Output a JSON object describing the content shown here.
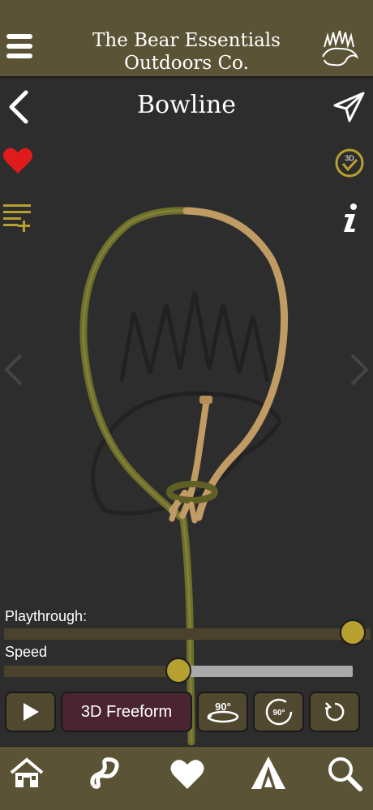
{
  "app": {
    "brand_line1": "The Bear Essentials",
    "brand_line2": "Outdoors Co."
  },
  "knot": {
    "title": "Bowline",
    "favorited": true
  },
  "icons": {
    "menu": "menu-icon",
    "logo": "bear-paw-logo",
    "back": "chevron-left-icon",
    "share": "send-icon",
    "favorite": "heart-icon",
    "mode_3d": "3d-check-icon",
    "add_list": "playlist-add-icon",
    "info": "info-icon"
  },
  "controls": {
    "playthrough_label": "Playthrough:",
    "playthrough_value": 0.97,
    "speed_label": "Speed",
    "speed_value": 0.5,
    "freeform_label": "3D Freeform",
    "rotate_h_label": "90°",
    "rotate_v_label": "90°"
  },
  "nav": {
    "items": [
      "home-icon",
      "rope-icon",
      "heart-icon",
      "camp-icon",
      "search-icon"
    ]
  },
  "colors": {
    "header": "#5b5336",
    "accent": "#b5a030",
    "rope_green": "#7a7a33",
    "rope_tan": "#c8a46d",
    "heart": "#e01b1b"
  }
}
